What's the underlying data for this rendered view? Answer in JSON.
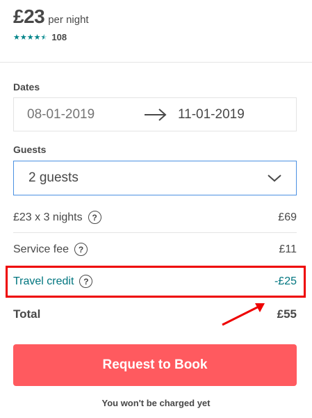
{
  "listing": {
    "price": "£23",
    "per_night": "per night",
    "rating_stars": 4.5,
    "review_count": "108"
  },
  "dates": {
    "label": "Dates",
    "check_in": "08-01-2019",
    "check_out": "11-01-2019"
  },
  "guests": {
    "label": "Guests",
    "selected": "2 guests"
  },
  "breakdown": {
    "nights": {
      "label": "£23 x 3 nights",
      "amount": "£69"
    },
    "service_fee": {
      "label": "Service fee",
      "amount": "£11"
    },
    "travel_credit": {
      "label": "Travel credit",
      "amount": "-£25"
    },
    "total": {
      "label": "Total",
      "amount": "£55"
    }
  },
  "actions": {
    "book_label": "Request to Book",
    "note": "You won't be charged yet"
  },
  "colors": {
    "brand": "#ff5a5f",
    "teal": "#008489",
    "highlight": "#ee0000",
    "focus_border": "#4a90e2"
  }
}
